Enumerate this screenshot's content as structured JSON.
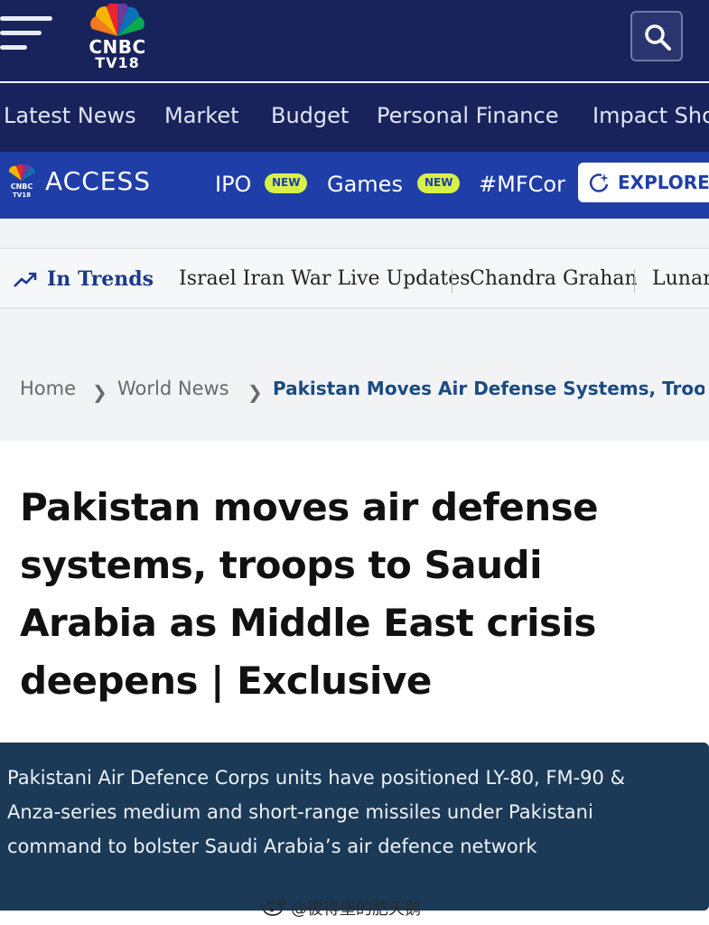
{
  "header": {
    "brand_line1": "CNBC",
    "brand_line2": "TV18",
    "peacock_colors": [
      "#f7b500",
      "#e8262f",
      "#6a3b9c",
      "#0b71b9",
      "#0aa84f",
      "#f27a1f"
    ],
    "menu_icon": "hamburger-icon",
    "search_icon": "search-icon"
  },
  "main_nav": {
    "items": [
      "Latest News",
      "Market",
      "Budget",
      "Personal Finance",
      "Impact Sho"
    ]
  },
  "access_bar": {
    "title": "ACCESS",
    "items": [
      {
        "label": "IPO",
        "badge": "NEW"
      },
      {
        "label": "Games",
        "badge": "NEW"
      },
      {
        "label": "#MFCor",
        "badge": ""
      }
    ],
    "explore_label": "EXPLORE",
    "accent": "#1f3ea8",
    "badge_color": "#d8f04a"
  },
  "trends": {
    "label": "In Trends",
    "items": [
      "Israel Iran War Live Updates",
      "Chandra Grahan",
      "Lunar"
    ]
  },
  "breadcrumb": {
    "home": "Home",
    "section": "World News",
    "current": "Pakistan Moves Air Defense Systems, Troops T"
  },
  "article": {
    "headline": "Pakistan moves air defense systems, troops to Saudi Arabia as Middle East crisis deepens | Exclusive",
    "summary": "Pakistani Air Defence Corps units have positioned LY-80, FM-90 & Anza-series medium and short-range missiles under Pakistani command to bolster Saudi Arabia’s air defence network"
  },
  "watermark": {
    "text": "@彼得堡的肥天鹅"
  }
}
